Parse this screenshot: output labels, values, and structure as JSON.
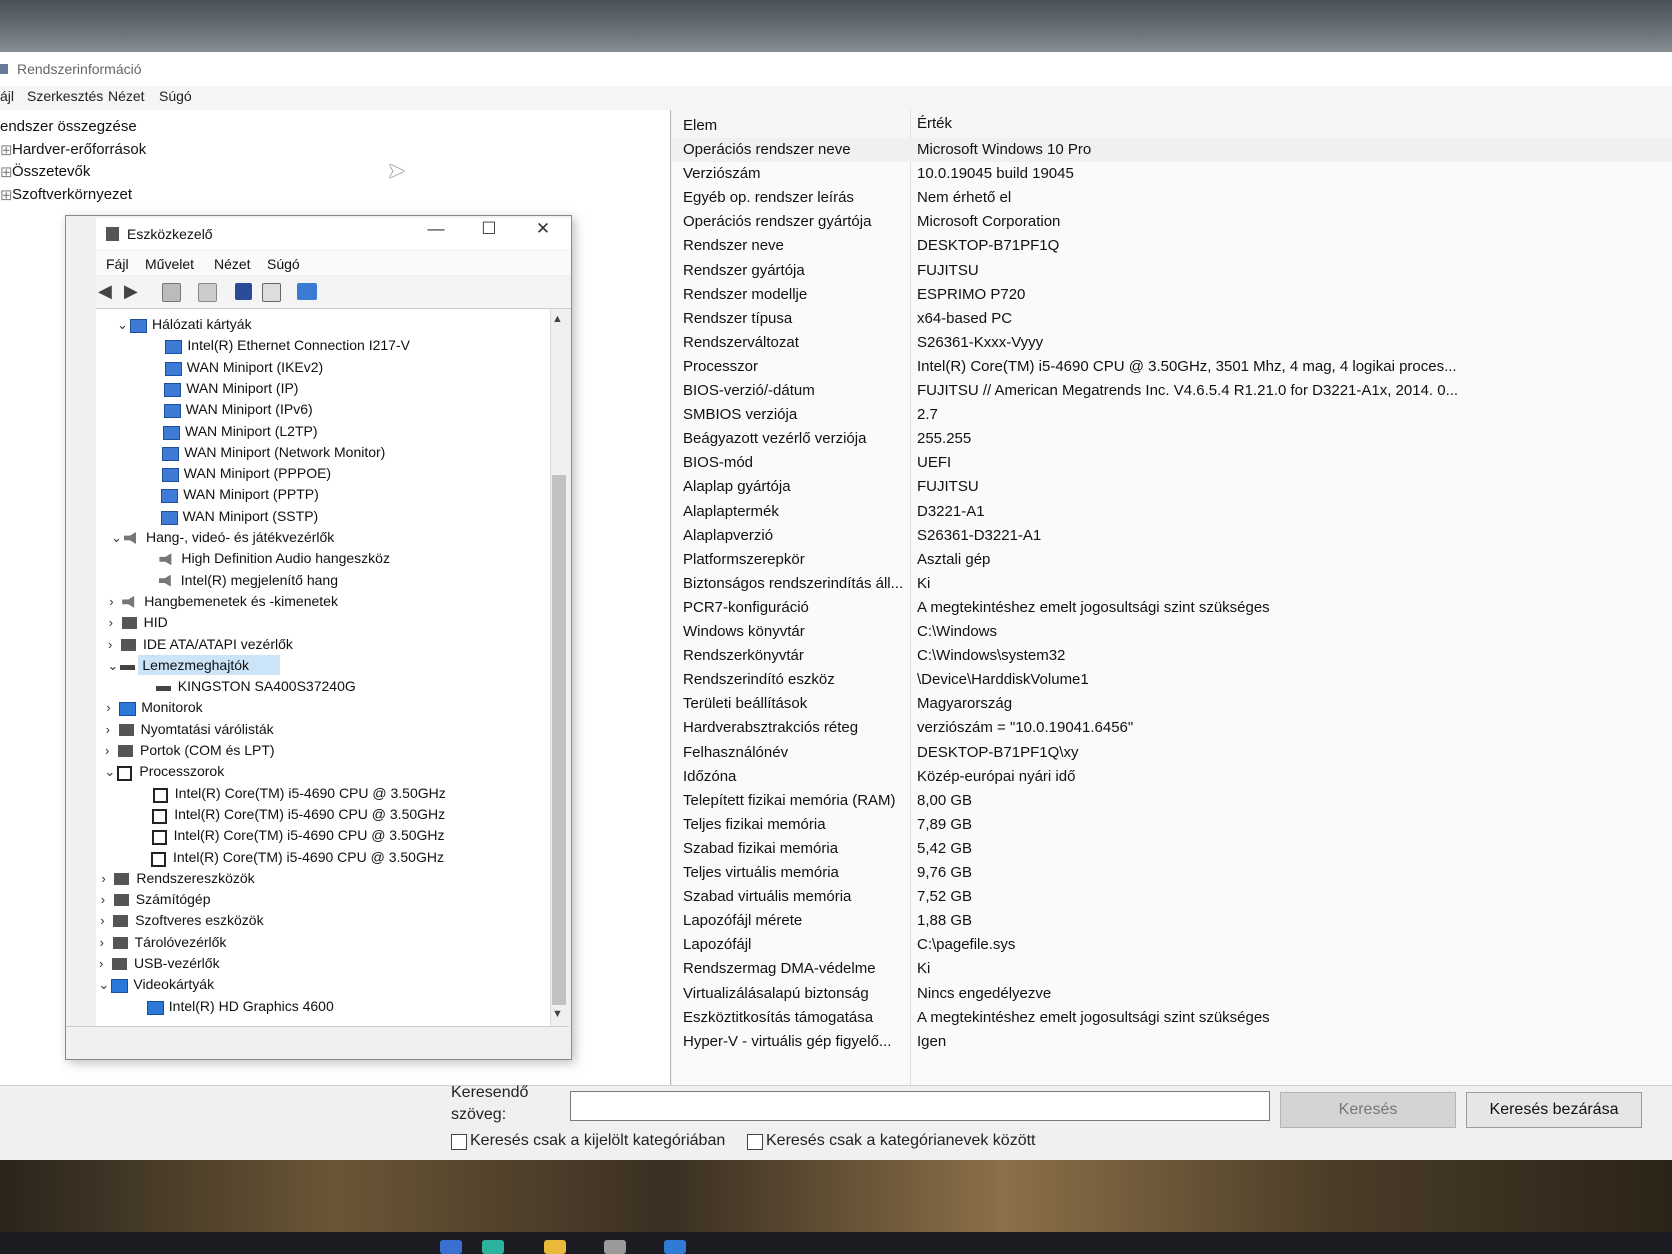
{
  "main_window": {
    "title": "Rendszerinformáció",
    "menu": [
      "ájl",
      "Szerkesztés",
      "Nézet",
      "Súgó"
    ],
    "tree": [
      "endszer összegzése",
      "Hardver-erőforrások",
      "Összetevők",
      "Szoftverkörnyezet"
    ],
    "list_headers": {
      "item": "Elem",
      "value": "Érték"
    },
    "rows": [
      {
        "name": "Operációs rendszer neve",
        "value": "Microsoft Windows 10 Pro"
      },
      {
        "name": "Verziószám",
        "value": "10.0.19045 build 19045"
      },
      {
        "name": "Egyéb op. rendszer leírás",
        "value": "Nem érhető el"
      },
      {
        "name": "Operációs rendszer gyártója",
        "value": "Microsoft Corporation"
      },
      {
        "name": "Rendszer neve",
        "value": "DESKTOP-B71PF1Q"
      },
      {
        "name": "Rendszer gyártója",
        "value": "FUJITSU"
      },
      {
        "name": "Rendszer modellje",
        "value": "ESPRIMO P720"
      },
      {
        "name": "Rendszer típusa",
        "value": "x64-based PC"
      },
      {
        "name": "Rendszerváltozat",
        "value": "S26361-Kxxx-Vyyy"
      },
      {
        "name": "Processzor",
        "value": "Intel(R) Core(TM) i5-4690 CPU @ 3.50GHz, 3501 Mhz, 4 mag, 4 logikai proces..."
      },
      {
        "name": "BIOS-verzió/-dátum",
        "value": "FUJITSU // American Megatrends Inc. V4.6.5.4 R1.21.0 for D3221-A1x, 2014. 0..."
      },
      {
        "name": "SMBIOS verziója",
        "value": "2.7"
      },
      {
        "name": "Beágyazott vezérlő verziója",
        "value": "255.255"
      },
      {
        "name": "BIOS-mód",
        "value": "UEFI"
      },
      {
        "name": "Alaplap gyártója",
        "value": "FUJITSU"
      },
      {
        "name": "Alaplaptermék",
        "value": "D3221-A1"
      },
      {
        "name": "Alaplapverzió",
        "value": "S26361-D3221-A1"
      },
      {
        "name": "Platformszerepkör",
        "value": "Asztali gép"
      },
      {
        "name": "Biztonságos rendszerindítás áll...",
        "value": "Ki"
      },
      {
        "name": "PCR7-konfiguráció",
        "value": "A megtekintéshez emelt jogosultsági szint szükséges"
      },
      {
        "name": "Windows könyvtár",
        "value": "C:\\Windows"
      },
      {
        "name": "Rendszerkönyvtár",
        "value": "C:\\Windows\\system32"
      },
      {
        "name": "Rendszerindító eszköz",
        "value": "\\Device\\HarddiskVolume1"
      },
      {
        "name": "Területi beállítások",
        "value": "Magyarország"
      },
      {
        "name": "Hardverabsztrakciós réteg",
        "value": "verziószám = \"10.0.19041.6456\""
      },
      {
        "name": "Felhasználónév",
        "value": "DESKTOP-B71PF1Q\\xy"
      },
      {
        "name": "Időzóna",
        "value": "Közép-európai nyári idő"
      },
      {
        "name": "Telepített fizikai memória (RAM)",
        "value": "8,00 GB"
      },
      {
        "name": "Teljes fizikai memória",
        "value": "7,89 GB"
      },
      {
        "name": "Szabad fizikai memória",
        "value": "5,42 GB"
      },
      {
        "name": "Teljes virtuális memória",
        "value": "9,76 GB"
      },
      {
        "name": "Szabad virtuális memória",
        "value": "7,52 GB"
      },
      {
        "name": "Lapozófájl mérete",
        "value": "1,88 GB"
      },
      {
        "name": "Lapozófájl",
        "value": "C:\\pagefile.sys"
      },
      {
        "name": "Rendszermag DMA-védelme",
        "value": "Ki"
      },
      {
        "name": "Virtualizálásalapú biztonság",
        "value": "Nincs engedélyezve"
      },
      {
        "name": "Eszköztitkosítás támogatása",
        "value": "A megtekintéshez emelt jogosultsági szint szükséges"
      },
      {
        "name": "Hyper-V - virtuális gép figyelő...",
        "value": "Igen"
      }
    ],
    "search": {
      "label": "Keresendő szöveg:",
      "value": "",
      "search_button": "Keresés",
      "close_button": "Keresés bezárása",
      "check_selected_category": "Keresés csak a kijelölt kategóriában",
      "check_category_names": "Keresés csak a kategórianevek között"
    }
  },
  "device_manager": {
    "title": "Eszközkezelő",
    "controls": {
      "minimize": "—",
      "maximize": "☐",
      "close": "✕"
    },
    "menu": [
      "Fájl",
      "Művelet",
      "Nézet",
      "Súgó"
    ],
    "tree": [
      {
        "label": "Hálózati kártyák",
        "expanded": true,
        "icon": "network-icon"
      },
      {
        "label": "Intel(R) Ethernet Connection I217-V",
        "icon": "network-icon"
      },
      {
        "label": "WAN Miniport (IKEv2)",
        "icon": "network-icon"
      },
      {
        "label": "WAN Miniport (IP)",
        "icon": "network-icon"
      },
      {
        "label": "WAN Miniport (IPv6)",
        "icon": "network-icon"
      },
      {
        "label": "WAN Miniport (L2TP)",
        "icon": "network-icon"
      },
      {
        "label": "WAN Miniport (Network Monitor)",
        "icon": "network-icon"
      },
      {
        "label": "WAN Miniport (PPPOE)",
        "icon": "network-icon"
      },
      {
        "label": "WAN Miniport (PPTP)",
        "icon": "network-icon"
      },
      {
        "label": "WAN Miniport (SSTP)",
        "icon": "network-icon"
      },
      {
        "label": "Hang-, videó- és játékvezérlők",
        "expanded": true,
        "icon": "speaker-icon"
      },
      {
        "label": "High Definition Audio hangeszköz",
        "icon": "speaker-icon"
      },
      {
        "label": "Intel(R) megjelenítő hang",
        "icon": "speaker-icon"
      },
      {
        "label": "Hangbemenetek és -kimenetek",
        "expanded": false,
        "icon": "speaker-icon"
      },
      {
        "label": "HID",
        "expanded": false,
        "icon": "hid-icon"
      },
      {
        "label": "IDE ATA/ATAPI vezérlők",
        "expanded": false,
        "icon": "ide-icon"
      },
      {
        "label": "Lemezmeghajtók",
        "expanded": true,
        "selected": true,
        "icon": "disk-icon"
      },
      {
        "label": "KINGSTON SA400S37240G",
        "icon": "disk-icon"
      },
      {
        "label": "Monitorok",
        "expanded": false,
        "icon": "monitor-icon"
      },
      {
        "label": "Nyomtatási várólisták",
        "expanded": false,
        "icon": "printer-icon"
      },
      {
        "label": "Portok (COM és LPT)",
        "expanded": false,
        "icon": "port-icon"
      },
      {
        "label": "Processzorok",
        "expanded": true,
        "icon": "cpu-icon"
      },
      {
        "label": "Intel(R) Core(TM) i5-4690 CPU @ 3.50GHz",
        "icon": "cpu-icon"
      },
      {
        "label": "Intel(R) Core(TM) i5-4690 CPU @ 3.50GHz",
        "icon": "cpu-icon"
      },
      {
        "label": "Intel(R) Core(TM) i5-4690 CPU @ 3.50GHz",
        "icon": "cpu-icon"
      },
      {
        "label": "Intel(R) Core(TM) i5-4690 CPU @ 3.50GHz",
        "icon": "cpu-icon"
      },
      {
        "label": "Rendszereszközök",
        "expanded": false,
        "icon": "folder-icon"
      },
      {
        "label": "Számítógép",
        "expanded": false,
        "icon": "computer-icon"
      },
      {
        "label": "Szoftveres eszközök",
        "expanded": false,
        "icon": "software-icon"
      },
      {
        "label": "Tárolóvezérlők",
        "expanded": false,
        "icon": "storage-icon"
      },
      {
        "label": "USB-vezérlők",
        "expanded": false,
        "icon": "usb-icon"
      },
      {
        "label": "Videokártyák",
        "expanded": true,
        "icon": "monitor-icon"
      },
      {
        "label": "Intel(R) HD Graphics 4600",
        "icon": "monitor-icon"
      }
    ]
  }
}
